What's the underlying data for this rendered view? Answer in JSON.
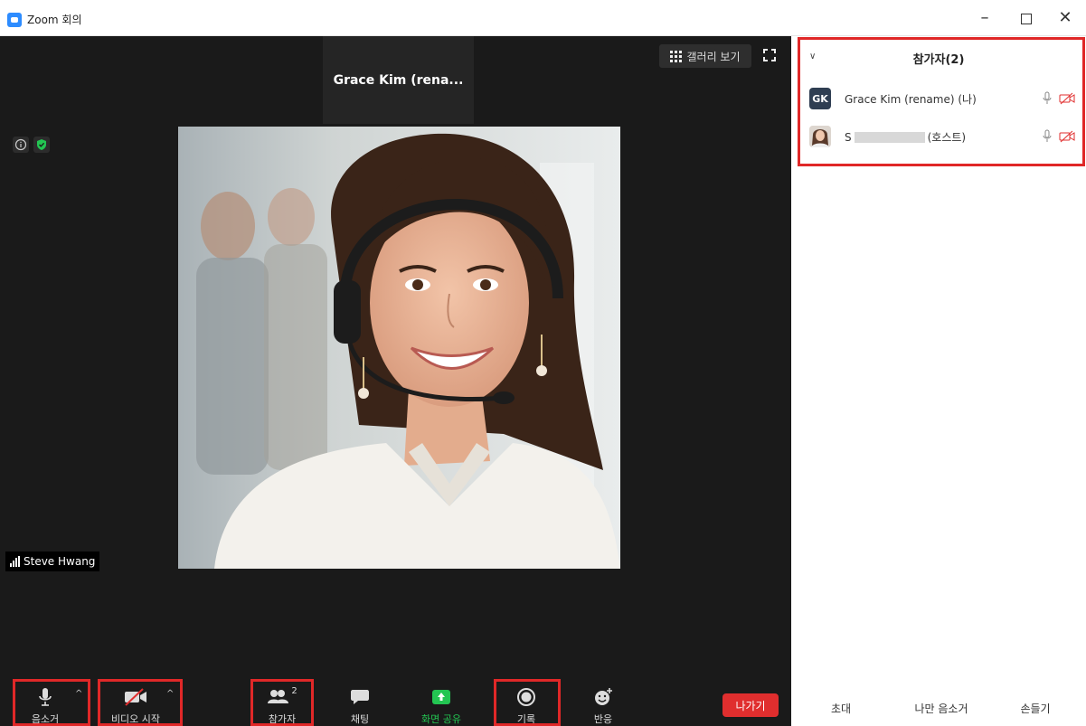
{
  "window": {
    "title": "Zoom 회의"
  },
  "meeting": {
    "gallery_view_label": "갤러리 보기",
    "active_speaker": "Grace Kim (rena...",
    "video_name_tag": "Steve Hwang"
  },
  "toolbar": {
    "mute": "음소거",
    "start_video": "비디오 시작",
    "participants": "참가자",
    "participants_count": "2",
    "chat": "채팅",
    "share_screen": "화면 공유",
    "record": "기록",
    "reactions": "반응",
    "leave": "나가기"
  },
  "panel": {
    "title": "참가자(2)",
    "participants": [
      {
        "initials": "GK",
        "name": "Grace Kim (rename) (나)"
      },
      {
        "name_prefix": "S",
        "name_suffix": "(호스트)"
      }
    ],
    "invite": "초대",
    "mute_me": "나만 음소거",
    "raise_hand": "손들기"
  },
  "colors": {
    "meeting_bg": "#1a1a1a",
    "accent": "#2d8cff",
    "leave": "#e02e2e",
    "highlight_box": "#e02828",
    "share_green": "#23c552",
    "avatar_gk": "#2f3e52"
  },
  "highlighted_elements": [
    "mute",
    "start_video",
    "participants",
    "record",
    "participants_panel"
  ]
}
